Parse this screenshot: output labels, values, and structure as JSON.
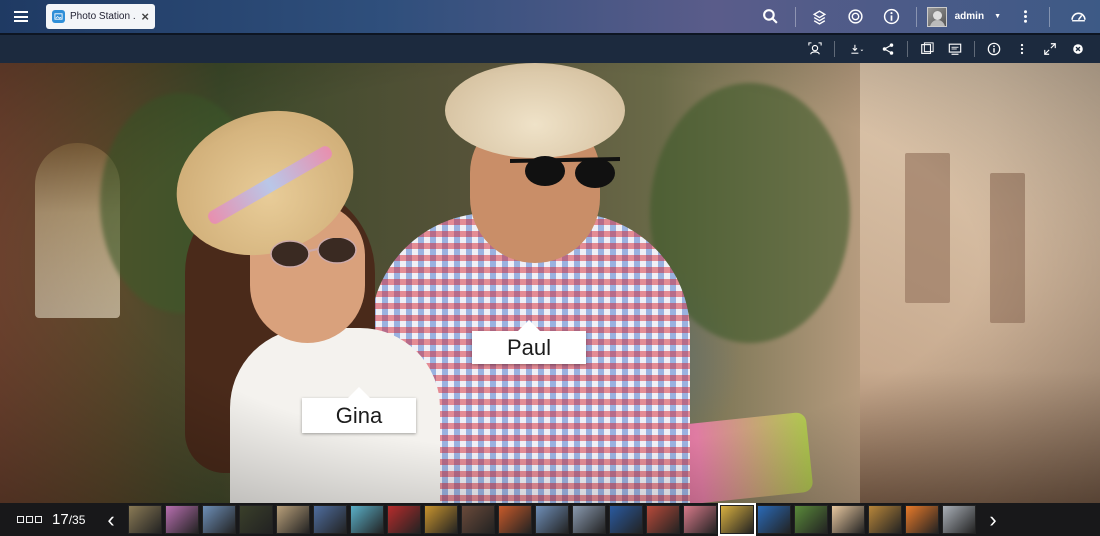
{
  "topbar": {
    "tab_label": "Photo Station ...",
    "tab_close": "×",
    "username": "admin",
    "icons": [
      "search-icon",
      "stack-icon",
      "sync-icon",
      "info-icon",
      "user-avatar",
      "more-icon",
      "dashboard-icon"
    ]
  },
  "viewer_toolbar": {
    "icons": [
      "face-tag-icon",
      "download-icon",
      "share-icon",
      "slideshow-icon",
      "cast-icon",
      "info-icon",
      "more-icon",
      "fullscreen-icon",
      "close-icon"
    ]
  },
  "photo": {
    "tags": [
      {
        "name": "Paul"
      },
      {
        "name": "Gina"
      }
    ]
  },
  "filmstrip": {
    "current": "17",
    "separator": "/",
    "total": "35",
    "prev": "‹",
    "next": "›",
    "thumb_colors": [
      "#8a7a55",
      "#b86fb0",
      "#6d8fb8",
      "#3a3f2a",
      "#b9a07a",
      "#4f6ea0",
      "#5ab0c8",
      "#b62c2c",
      "#c8942e",
      "#6a4a3a",
      "#c85a2a",
      "#6f8fb8",
      "#8a9ab0",
      "#2a5aa0",
      "#b84a3a",
      "#d87a8a",
      "#d8b040",
      "#2a6ab8",
      "#5a8a3a",
      "#e8c8a0",
      "#b8863a",
      "#e87a2a",
      "#aab0b8"
    ],
    "active_index": 16
  },
  "colors": {
    "topbar_start": "#1f3a63",
    "toolbar_bg": "#1c2a3e",
    "filmstrip_bg": "#18181a"
  }
}
